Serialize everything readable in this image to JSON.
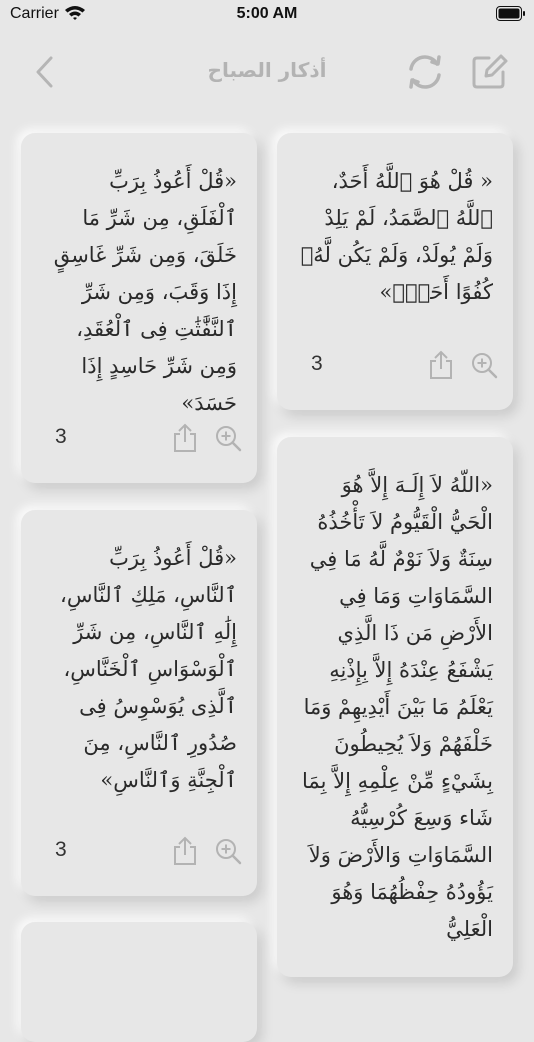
{
  "status_bar": {
    "carrier": "Carrier",
    "time": "5:00 AM"
  },
  "nav": {
    "title": "أذكار الصباح"
  },
  "cards": [
    {
      "text": "« قُلْ هُوَ ٱللَّهُ أَحَدٌ، ٱللَّهُ ٱلصَّمَدُ، لَمْ يَلِدْ وَلَمْ يُولَدْ، وَلَمْ يَكُن لَّهُۥ كُفُوًا أَحَدٌۢ»",
      "count": "3"
    },
    {
      "text": "«قُلْ أَعُوذُ بِرَبِّ ٱلْفَلَقِ، مِن شَرِّ مَا خَلَقَ، وَمِن شَرِّ غَاسِقٍ إِذَا وَقَبَ، وَمِن شَرِّ ٱلنَّفَّٰثَٰتِ فِى ٱلْعُقَدِ، وَمِن شَرِّ حَاسِدٍ إِذَا حَسَدَ»",
      "count": "3"
    },
    {
      "text": "«اللّهُ لاَ إِلَـهَ إِلاَّ هُوَ الْحَيُّ الْقَيُّومُ لاَ تَأْخُذُهُ سِنَةٌ وَلاَ نَوْمٌ لَّهُ مَا فِي السَّمَاوَاتِ وَمَا فِي الأَرْضِ مَن ذَا الَّذِي يَشْفَعُ عِنْدَهُ إِلاَّ بِإِذْنِهِ يَعْلَمُ مَا بَيْنَ أَيْدِيهِمْ وَمَا خَلْفَهُمْ وَلاَ يُحِيطُونَ بِشَيْءٍ مِّنْ عِلْمِهِ إِلاَّ بِمَا شَاء وَسِعَ كُرْسِيُّهُ السَّمَاوَاتِ وَالأَرْضَ وَلاَ يَؤُودُهُ حِفْظُهُمَا وَهُوَ الْعَلِيُّ",
      "count": ""
    },
    {
      "text": "«قُلْ أَعُوذُ بِرَبِّ ٱلنَّاسِ، مَلِكِ ٱلنَّاسِ، إِلَٰهِ ٱلنَّاسِ، مِن شَرِّ ٱلْوَسْوَاسِ ٱلْخَنَّاسِ، ٱلَّذِى يُوَسْوِسُ فِى صُدُورِ ٱلنَّاسِ، مِنَ ٱلْجِنَّةِ وَٱلنَّاسِ»",
      "count": "3"
    }
  ]
}
